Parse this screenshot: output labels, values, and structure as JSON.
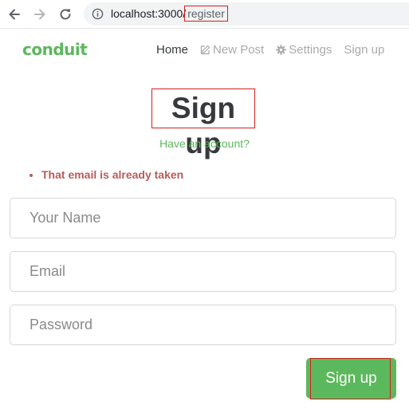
{
  "browser": {
    "url_host": "localhost:3000/",
    "url_path": "register",
    "icons": {
      "back": "arrow-left-icon",
      "forward": "arrow-right-icon",
      "reload": "reload-icon",
      "info": "info-icon"
    }
  },
  "navbar": {
    "brand": "conduit",
    "links": [
      {
        "label": "Home",
        "active": true
      },
      {
        "label": "New Post",
        "icon": "edit-icon"
      },
      {
        "label": "Settings",
        "icon": "gear-icon"
      },
      {
        "label": "Sign up"
      }
    ]
  },
  "page": {
    "title": "Sign up",
    "have_account": "Have an account?",
    "errors": [
      "That email is already taken"
    ]
  },
  "form": {
    "name_placeholder": "Your Name",
    "email_placeholder": "Email",
    "password_placeholder": "Password",
    "submit_label": "Sign up"
  },
  "colors": {
    "brand": "#5cb85c",
    "error": "#b85c5c",
    "annotation": "#d62020"
  }
}
